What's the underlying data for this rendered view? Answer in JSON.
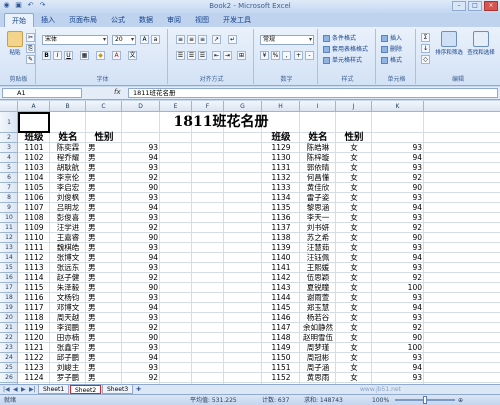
{
  "window": {
    "title": "Book2 - Microsoft Excel"
  },
  "ribbon_tabs": [
    "开始",
    "插入",
    "页面布局",
    "公式",
    "数据",
    "审阅",
    "视图",
    "开发工具"
  ],
  "ribbon": {
    "clipboard": {
      "paste": "粘贴",
      "label": "剪贴板"
    },
    "font": {
      "name": "宋体",
      "size": "20",
      "label": "字体"
    },
    "alignment": {
      "label": "对齐方式"
    },
    "number": {
      "format": "常规",
      "label": "数字"
    },
    "styles": {
      "conditional": "条件格式",
      "table": "套用表格格式",
      "cell": "单元格样式",
      "label": "样式"
    },
    "cells": {
      "insert": "插入",
      "delete": "删除",
      "format": "格式",
      "label": "单元格"
    },
    "editing": {
      "sort": "排序和筛选",
      "find": "查找和选择",
      "label": "编辑"
    }
  },
  "formula_bar": {
    "name_box": "A1",
    "fx": "fx",
    "content": "1811班花名册"
  },
  "columns": [
    "A",
    "B",
    "C",
    "D",
    "E",
    "F",
    "G",
    "H",
    "I",
    "J",
    "K"
  ],
  "rows": [
    "1",
    "2",
    "3",
    "4",
    "5",
    "6",
    "7",
    "8",
    "9",
    "10",
    "11",
    "12",
    "13",
    "14",
    "15",
    "16",
    "17",
    "18",
    "19",
    "20",
    "21",
    "22",
    "23",
    "24",
    "25",
    "26"
  ],
  "sheet_title": "1811班花名册",
  "left_headers": [
    "班级",
    "姓名",
    "性别"
  ],
  "right_headers": [
    "班级",
    "姓名",
    "性别"
  ],
  "left_table": [
    [
      "1101",
      "陈奕霖",
      "男",
      "93"
    ],
    [
      "1102",
      "程乔耀",
      "男",
      "94"
    ],
    [
      "1103",
      "胡耿航",
      "男",
      "93"
    ],
    [
      "1104",
      "李京伦",
      "男",
      "92"
    ],
    [
      "1105",
      "李启宏",
      "男",
      "90"
    ],
    [
      "1106",
      "刘俊枫",
      "男",
      "93"
    ],
    [
      "1107",
      "吕明龙",
      "男",
      "94"
    ],
    [
      "1108",
      "彭俊喜",
      "男",
      "93"
    ],
    [
      "1109",
      "汪学进",
      "男",
      "92"
    ],
    [
      "1110",
      "王嘉睿",
      "男",
      "90"
    ],
    [
      "1111",
      "魏棋皓",
      "男",
      "93"
    ],
    [
      "1112",
      "张博文",
      "男",
      "94"
    ],
    [
      "1113",
      "张远东",
      "男",
      "93"
    ],
    [
      "1114",
      "赵子健",
      "男",
      "92"
    ],
    [
      "1115",
      "朱泽毅",
      "男",
      "90"
    ],
    [
      "1116",
      "文杨钧",
      "男",
      "93"
    ],
    [
      "1117",
      "邓博文",
      "男",
      "94"
    ],
    [
      "1118",
      "周天越",
      "男",
      "93"
    ],
    [
      "1119",
      "李润鹏",
      "男",
      "92"
    ],
    [
      "1120",
      "田亦楠",
      "男",
      "90"
    ],
    [
      "1121",
      "张鑫宇",
      "男",
      "93"
    ],
    [
      "1122",
      "邱子鹏",
      "男",
      "94"
    ],
    [
      "1123",
      "刘峻主",
      "男",
      "93"
    ],
    [
      "1124",
      "罗子鹏",
      "男",
      "92"
    ]
  ],
  "right_table": [
    [
      "1129",
      "陈皓琳",
      "女",
      "93"
    ],
    [
      "1130",
      "陈梓璇",
      "女",
      "94"
    ],
    [
      "1131",
      "郭依晴",
      "女",
      "93"
    ],
    [
      "1132",
      "何昌懂",
      "女",
      "92"
    ],
    [
      "1133",
      "黄佳欣",
      "女",
      "90"
    ],
    [
      "1134",
      "雷子姿",
      "女",
      "93"
    ],
    [
      "1135",
      "黎思涵",
      "女",
      "94"
    ],
    [
      "1136",
      "李天一",
      "女",
      "93"
    ],
    [
      "1137",
      "刘书妍",
      "女",
      "92"
    ],
    [
      "1138",
      "苏之希",
      "女",
      "90"
    ],
    [
      "1139",
      "汪慧茹",
      "女",
      "93"
    ],
    [
      "1140",
      "汪钰佩",
      "女",
      "94"
    ],
    [
      "1141",
      "王熙媛",
      "女",
      "93"
    ],
    [
      "1142",
      "伍思颖",
      "女",
      "92"
    ],
    [
      "1143",
      "夏锐瞳",
      "女",
      "100"
    ],
    [
      "1144",
      "谢雨萱",
      "女",
      "93"
    ],
    [
      "1145",
      "郑玉慧",
      "女",
      "94"
    ],
    [
      "1146",
      "杨若谷",
      "女",
      "93"
    ],
    [
      "1147",
      "余如静然",
      "女",
      "92"
    ],
    [
      "1148",
      "赵明雪伍",
      "女",
      "90"
    ],
    [
      "1149",
      "周梦瑾",
      "女",
      "100"
    ],
    [
      "1150",
      "周冠彬",
      "女",
      "93"
    ],
    [
      "1151",
      "周子涵",
      "女",
      "94"
    ],
    [
      "1152",
      "黄思雨",
      "女",
      "93"
    ]
  ],
  "sheet_tabs": [
    "Sheet1",
    "Sheet2",
    "Sheet3"
  ],
  "status": {
    "mode": "就绪",
    "average": "平均值: 531.225",
    "count": "计数: 637",
    "sum": "求和: 148743",
    "zoom": "100%"
  },
  "watermark": "www.jb51.net"
}
